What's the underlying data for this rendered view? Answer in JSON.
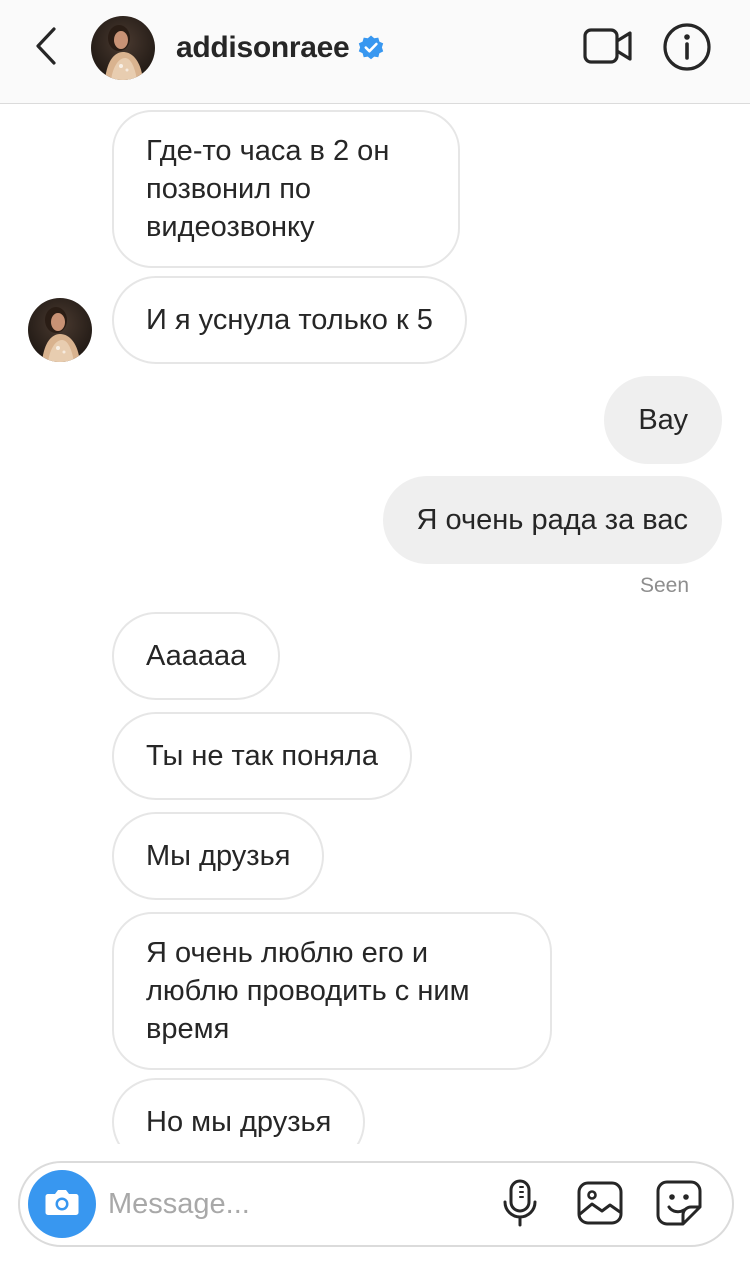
{
  "header": {
    "username": "addisonraee",
    "verified": true,
    "icons": {
      "back": "chevron-left-icon",
      "video": "video-camera-icon",
      "info": "info-icon",
      "verified": "verified-badge-icon"
    }
  },
  "messages": [
    {
      "from": "them",
      "text": "Где-то часа в 2 он позвонил по видеозвонку"
    },
    {
      "from": "them",
      "text": "И я уснула только к 5"
    },
    {
      "from": "me",
      "text": "Вау"
    },
    {
      "from": "me",
      "text": "Я очень рада за вас"
    },
    {
      "from": "them",
      "text": "Аааааа"
    },
    {
      "from": "them",
      "text": "Ты не так поняла"
    },
    {
      "from": "them",
      "text": "Мы друзья"
    },
    {
      "from": "them",
      "text": "Я очень люблю его и люблю проводить с ним время"
    },
    {
      "from": "them",
      "text": "Но мы друзья"
    }
  ],
  "seen_label": "Seen",
  "composer": {
    "placeholder": "Message...",
    "icons": [
      "camera-icon",
      "microphone-icon",
      "gallery-icon",
      "sticker-icon"
    ]
  },
  "colors": {
    "accent": "#3897f0",
    "verified": "#3897f0",
    "outgoing_bubble": "#efefef",
    "incoming_border": "#e6e6e6",
    "muted_text": "#8e8e8e"
  }
}
